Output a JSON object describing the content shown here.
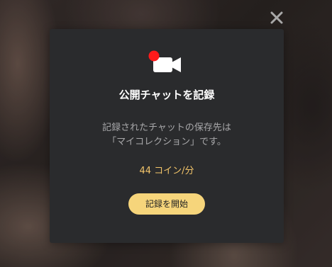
{
  "modal": {
    "close_icon": "close-icon",
    "record_icon": "video-camera-record-icon",
    "title": "公開チャットを記録",
    "description_line1": "記録されたチャットの保存先は",
    "description_line2": "「マイコレクション」です。",
    "price": "44 コイン/分",
    "start_button_label": "記録を開始"
  },
  "colors": {
    "modal_background": "#2a2b2d",
    "title_text": "#ffffff",
    "description_text": "#a8a8aa",
    "price_text": "#f3c56a",
    "button_background": "#f6d57b",
    "record_dot": "#ff1a1a",
    "close_icon": "#a9a9a9"
  }
}
